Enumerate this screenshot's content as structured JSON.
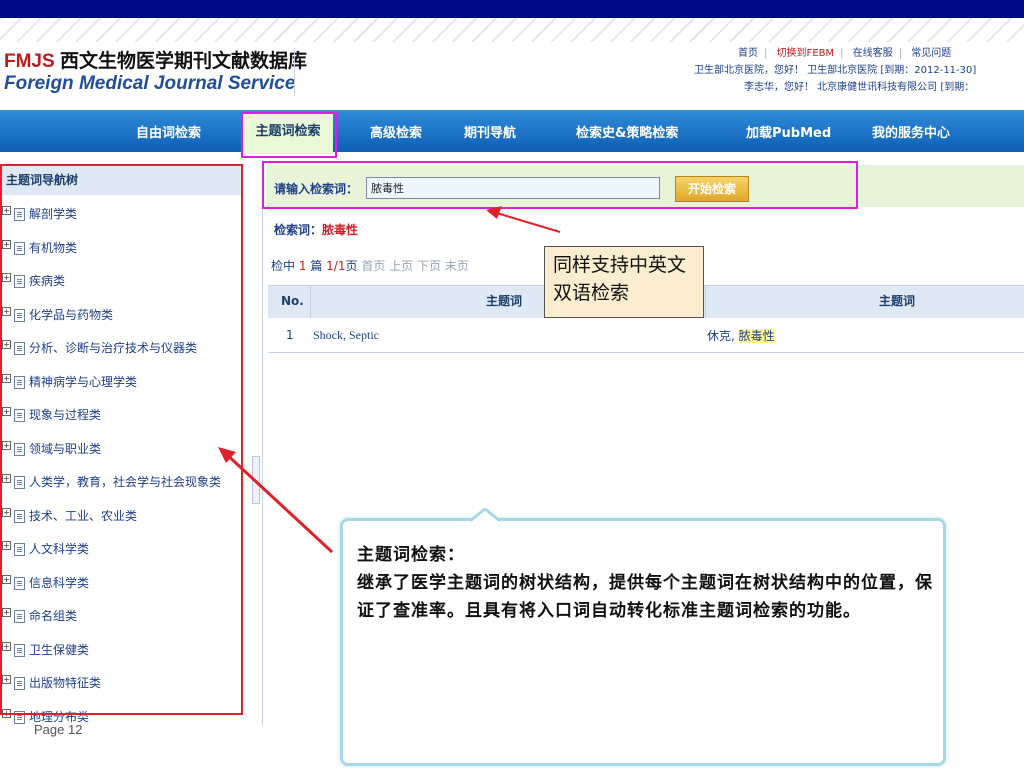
{
  "header": {
    "logo_fmjs": "FMJS",
    "logo_cn": "西文生物医学期刊文献数据库",
    "logo_en": "Foreign Medical Journal Service",
    "links": [
      "首页",
      "切换到FEBM",
      "在线客服",
      "常见问题"
    ],
    "line2": "卫生部北京医院，您好！ 卫生部北京医院 [到期：2012-11-30]",
    "line3": "李志华，您好！ 北京康健世讯科技有限公司 [到期："
  },
  "nav": {
    "items": [
      "自由词检索",
      "主题词检索",
      "高级检索",
      "期刊导航",
      "检索史&策略检索",
      "加载PubMed",
      "我的服务中心"
    ],
    "active_index": 1
  },
  "sidebar": {
    "title": "主题词导航树",
    "items": [
      "解剖学类",
      "有机物类",
      "疾病类",
      "化学品与药物类",
      "分析、诊断与治疗技术与仪器类",
      "精神病学与心理学类",
      "现象与过程类",
      "领域与职业类",
      "人类学，教育，社会学与社会现象类",
      "技术、工业、农业类",
      "人文科学类",
      "信息科学类",
      "命名组类",
      "卫生保健类",
      "出版物特征类",
      "地理分布类"
    ]
  },
  "search": {
    "label": "请输入检索词：",
    "value": "脓毒性",
    "button": "开始检索",
    "keyword_label": "检索词：",
    "keyword_value": "脓毒性"
  },
  "pager": {
    "prefix": "检中",
    "count": "1",
    "unit": "篇",
    "page": "1/1",
    "page_unit": "页",
    "links": "首页 上页 下页 末页"
  },
  "results": {
    "headers": [
      "No.",
      "主题词",
      "主题词"
    ],
    "rows": [
      {
        "no": "1",
        "en": "Shock, Septic",
        "cn_prefix": "休克, ",
        "cn_highlight": "脓毒性"
      }
    ]
  },
  "annotations": {
    "callout1": "同样支持中英文双语检索",
    "callout2_title": "主题词检索：",
    "callout2_body": "继承了医学主题词的树状结构，提供每个主题词在树状结构中的位置，保证了查准率。且具有将入口词自动转化标准主题词检索的功能。",
    "page_label": "Page  12"
  },
  "colors": {
    "top_bar": "#000c87",
    "nav_blue": "#1a6fc4",
    "highlight_box": "#e01ee0",
    "annotation_red": "#e0202a"
  }
}
